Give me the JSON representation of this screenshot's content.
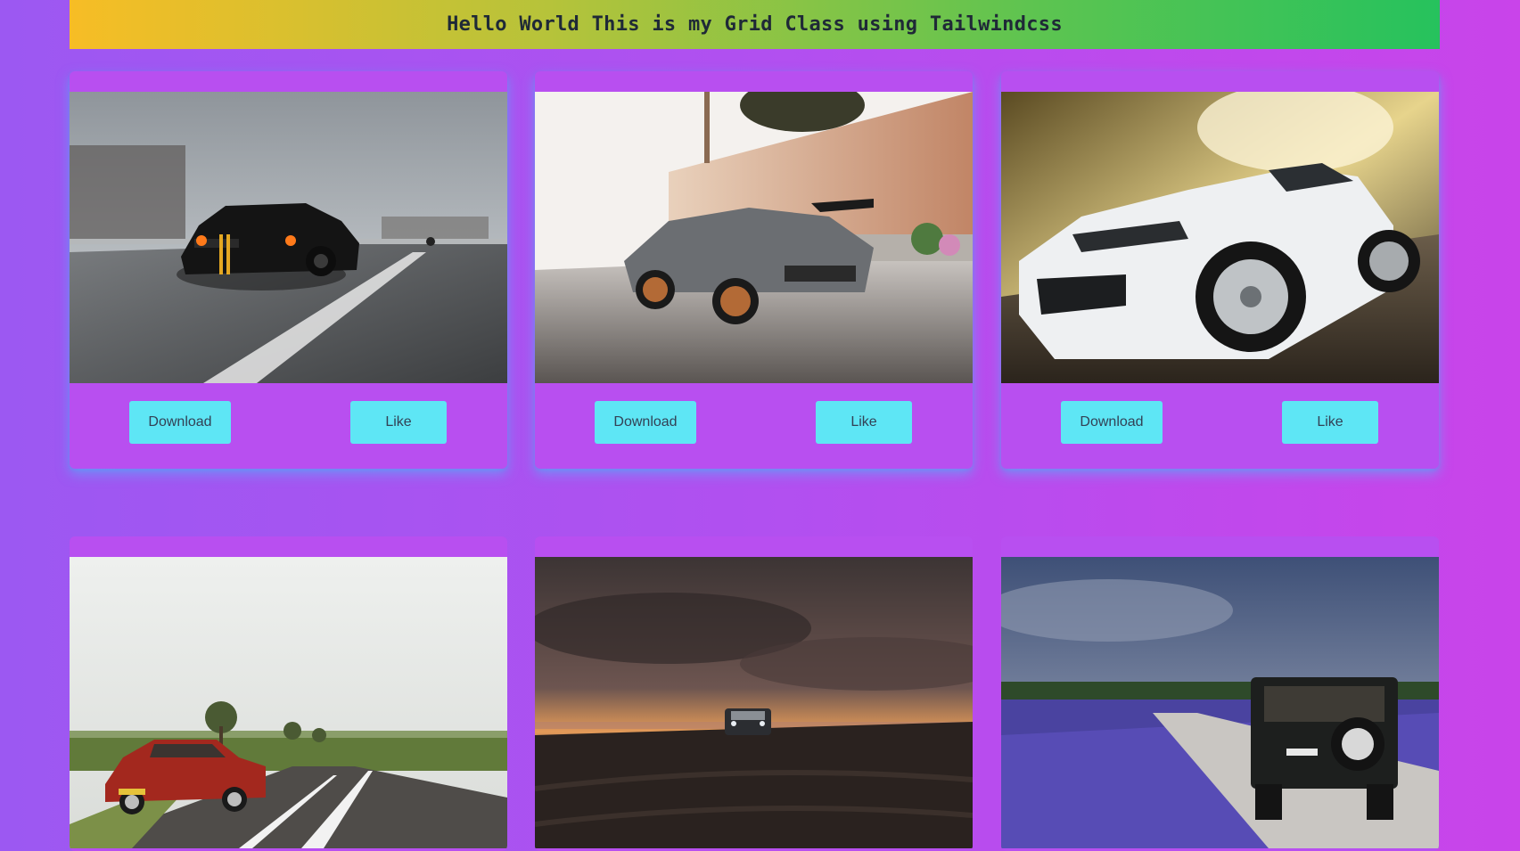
{
  "header": {
    "title": "Hello World This is my Grid Class using Tailwindcss"
  },
  "colors": {
    "background_start": "#9c58f2",
    "background_end": "#c944ea",
    "header_start": "#f7bd25",
    "header_end": "#26c25d",
    "button": "#5ee6f5",
    "card": "#b84ff0"
  },
  "cards": [
    {
      "image": "black-muscle-car-on-highway",
      "download_label": "Download",
      "like_label": "Like"
    },
    {
      "image": "grey-supercar-by-brick-wall",
      "download_label": "Download",
      "like_label": "Like"
    },
    {
      "image": "white-sports-car-motion-blur",
      "download_label": "Download",
      "like_label": "Like"
    },
    {
      "image": "red-sedan-on-country-road"
    },
    {
      "image": "suv-on-beach-at-sunset"
    },
    {
      "image": "offroad-jeep-in-lavender-field"
    }
  ]
}
